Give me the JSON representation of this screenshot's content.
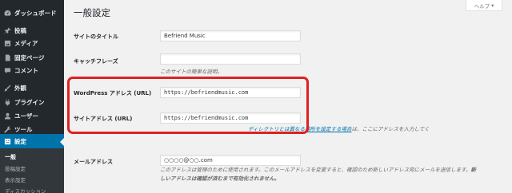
{
  "sidebar": {
    "items": [
      {
        "label": "ダッシュボード",
        "icon": "dashboard-icon"
      },
      {
        "label": "投稿",
        "icon": "pin-icon"
      },
      {
        "label": "メディア",
        "icon": "media-icon"
      },
      {
        "label": "固定ページ",
        "icon": "page-icon"
      },
      {
        "label": "コメント",
        "icon": "comment-icon"
      },
      {
        "label": "外観",
        "icon": "brush-icon"
      },
      {
        "label": "プラグイン",
        "icon": "plugin-icon"
      },
      {
        "label": "ユーザー",
        "icon": "user-icon"
      },
      {
        "label": "ツール",
        "icon": "wrench-icon"
      },
      {
        "label": "設定",
        "icon": "settings-icon"
      }
    ],
    "submenu": [
      "一般",
      "投稿設定",
      "表示設定",
      "ディスカッション"
    ]
  },
  "help_tab": {
    "label": "ヘルプ"
  },
  "page_title": "一般設定",
  "fields": {
    "site_title": {
      "label": "サイトのタイトル",
      "value": "Befriend Music"
    },
    "tagline": {
      "label": "キャッチフレーズ",
      "value": "",
      "description": "このサイトの簡単な説明。"
    },
    "wp_address": {
      "label": "WordPress アドレス (URL)",
      "value": "https://befriendmusic.com"
    },
    "site_address": {
      "label": "サイトアドレス (URL)",
      "value": "https://befriendmusic.com",
      "description_link": "ディレクトリとは異なる場所を設定する場合",
      "description_suffix": "は、ここにアドレスを入力してく"
    },
    "admin_email": {
      "label": "メールアドレス",
      "value": "○○○○@○○.com",
      "description_1": "このアドレスは管理のために使用されます。このメールアドレスを変更すると、確認のため新しいアドレス宛にメールを送信します。",
      "description_1_bold": "新",
      "description_2_bold": "しいアドレスは確認が済むまで有効化されません。"
    }
  }
}
